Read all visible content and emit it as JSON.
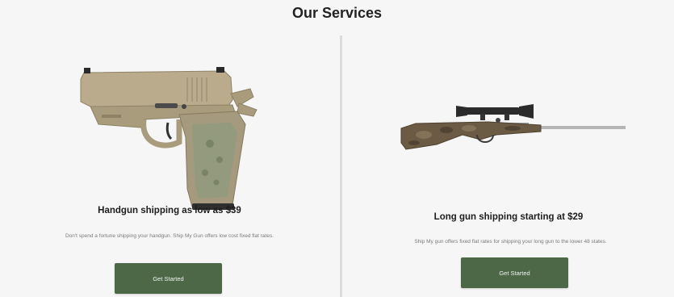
{
  "header": {
    "title": "Our Services"
  },
  "services": [
    {
      "image_icon": "handgun-image",
      "heading": "Handgun shipping as low as $39",
      "description": "Don't spend a fortune shipping your handgun. Ship My Gun offers low cost fixed flat rates.",
      "button_label": "Get Started"
    },
    {
      "image_icon": "rifle-image",
      "heading": "Long gun shipping starting at $29",
      "description": "Ship My gun offers fixed flat rates for shipping your long gun to the lower 48 states.",
      "button_label": "Get Started"
    }
  ],
  "colors": {
    "background": "#f6f6f6",
    "button": "#4c6847",
    "button_text": "#f2f2f2",
    "divider": "#dcdcdc",
    "handgun_frame": "#b7a98a",
    "rifle_stock": "#6b5a44"
  }
}
